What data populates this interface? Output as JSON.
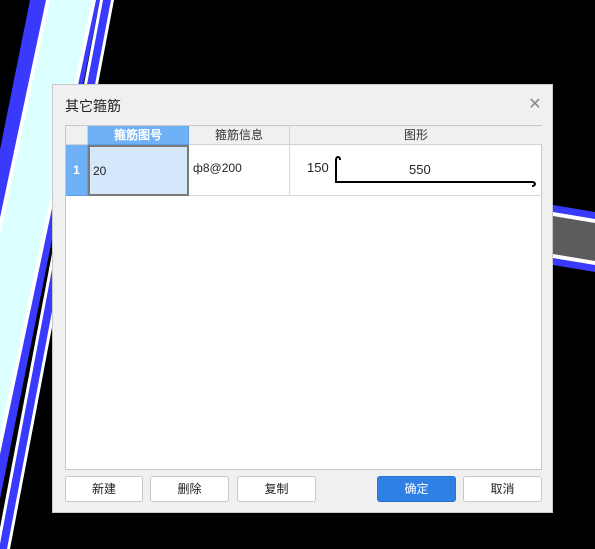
{
  "dialog": {
    "title": "其它箍筋",
    "close_icon": "close-icon"
  },
  "table": {
    "columns": [
      "箍筋图号",
      "箍筋信息",
      "图形"
    ],
    "rows": [
      {
        "index": "1",
        "figure_no": "20",
        "info": "ф8@200",
        "shape": {
          "left_label": "150",
          "length_label": "550"
        }
      }
    ]
  },
  "buttons": {
    "new": "新建",
    "delete": "删除",
    "copy": "复制",
    "ok": "确定",
    "cancel": "取消"
  },
  "colors": {
    "accent": "#2f80e4",
    "header_selected": "#6fb1f6",
    "cell_selected": "#d5e7fb",
    "bg_stripe": "#3a3aff",
    "bg_fill": "#dcffff"
  }
}
